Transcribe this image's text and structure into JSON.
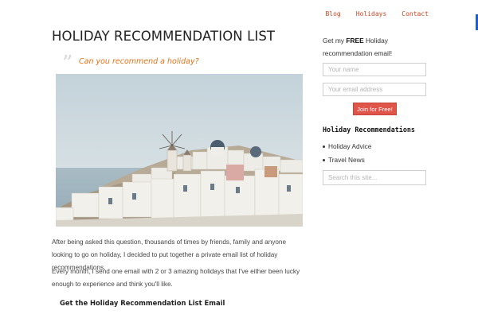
{
  "nav": {
    "items": [
      {
        "label": "Blog"
      },
      {
        "label": "Holidays"
      },
      {
        "label": "Contact"
      }
    ]
  },
  "main": {
    "title": "HOLIDAY RECOMMENDATION LIST",
    "quote_mark": "”",
    "pull_quote": "Can you recommend a holiday?",
    "paragraph_1": "After being asked this question, thousands of times by friends, family and anyone looking to go on holiday, I decided to put together a private email list of holiday recommendations.",
    "paragraph_2": "Every month, I send one email with 2 or 3 amazing holidays that I've either been lucky enough to experience and think you'll like.",
    "cta_heading": "Get the Holiday Recommendation List Email"
  },
  "sidebar": {
    "signup_prefix": "Get my ",
    "signup_emphasis": "FREE",
    "signup_suffix": " Holiday recommendation email!",
    "name_placeholder": "Your name",
    "email_placeholder": "Your email address",
    "join_label": "Join for Free!",
    "section_heading": "Holiday Recommendations",
    "links": [
      {
        "label": "Holiday Advice"
      },
      {
        "label": "Travel News"
      }
    ],
    "search_placeholder": "Search this site..."
  },
  "colors": {
    "nav_link": "#d2431e",
    "pull_quote": "#e07319",
    "join_button": "#e0554a",
    "accent_bar": "#1a5fd6"
  }
}
